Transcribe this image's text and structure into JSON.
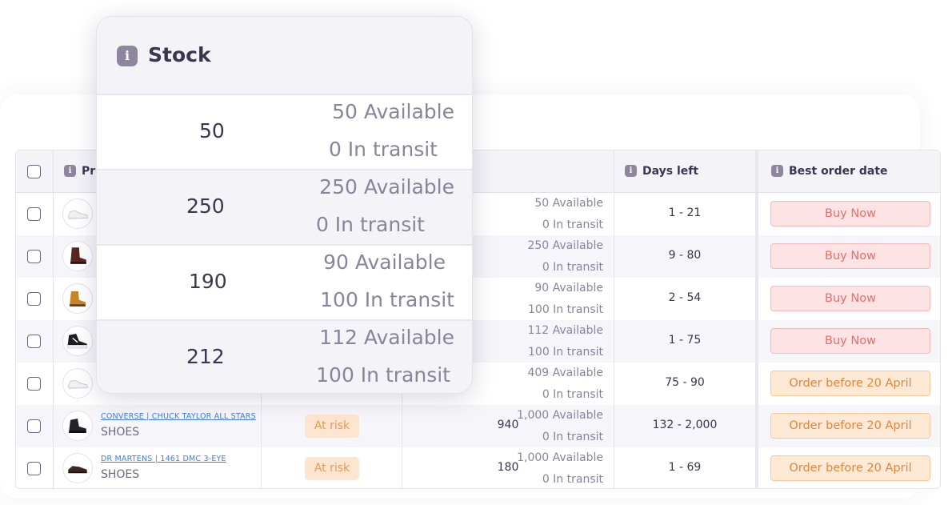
{
  "popover": {
    "title": "Stock",
    "rows": [
      {
        "total": "50",
        "available": "50 Available",
        "in_transit": "0 In transit"
      },
      {
        "total": "250",
        "available": "250 Available",
        "in_transit": "0 In transit"
      },
      {
        "total": "190",
        "available": "90 Available",
        "in_transit": "100 In transit"
      },
      {
        "total": "212",
        "available": "112 Available",
        "in_transit": "100 In transit"
      }
    ]
  },
  "table": {
    "headers": {
      "product": "Pr",
      "days_left": "Days left",
      "best_order_date": "Best order date"
    },
    "rows": [
      {
        "name": "",
        "category": "",
        "risk": "",
        "stock": "",
        "available": "50 Available",
        "in_transit": "0 In transit",
        "days_left": "1 - 21",
        "action": "Buy Now",
        "action_type": "buy",
        "thumb": "white-sneaker"
      },
      {
        "name": "",
        "category": "",
        "risk": "",
        "stock": "",
        "available": "250 Available",
        "in_transit": "0 In transit",
        "days_left": "9 - 80",
        "action": "Buy Now",
        "action_type": "buy",
        "thumb": "brown-boot"
      },
      {
        "name": "",
        "category": "",
        "risk": "",
        "stock": "",
        "available": "90 Available",
        "in_transit": "100 In transit",
        "days_left": "2 - 54",
        "action": "Buy Now",
        "action_type": "buy",
        "thumb": "tan-boot"
      },
      {
        "name": "",
        "category": "",
        "risk": "",
        "stock": "",
        "available": "112 Available",
        "in_transit": "100 In transit",
        "days_left": "1 - 75",
        "action": "Buy Now",
        "action_type": "buy",
        "thumb": "black-sneaker"
      },
      {
        "name": "",
        "category": "",
        "risk": "",
        "stock": "",
        "available": "409 Available",
        "in_transit": "0 In transit",
        "days_left": "75 - 90",
        "action": "Order before 20 April",
        "action_type": "order",
        "thumb": "white-sneaker"
      },
      {
        "name": "CONVERSE | CHUCK TAYLOR ALL STARS",
        "category": "SHOES",
        "risk": "At risk",
        "stock": "940",
        "available": "1,000 Available",
        "in_transit": "0 In transit",
        "days_left": "132 - 2,000",
        "action": "Order before 20 April",
        "action_type": "order",
        "thumb": "black-boot"
      },
      {
        "name": "DR MARTENS | 1461 DMC 3-EYE",
        "category": "SHOES",
        "risk": "At risk",
        "stock": "180",
        "available": "1,000 Available",
        "in_transit": "0 In transit",
        "days_left": "1 - 69",
        "action": "Order before 20 April",
        "action_type": "order",
        "thumb": "dark-oxford"
      }
    ]
  },
  "colors": {
    "buy_bg": "#fde3e3",
    "order_bg": "#fde9d4",
    "risk_bg": "#fde5cf",
    "link": "#3f7fe0"
  }
}
